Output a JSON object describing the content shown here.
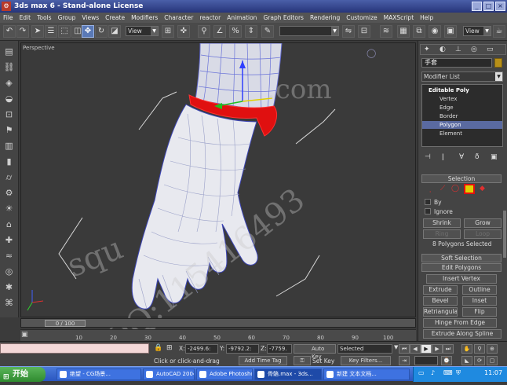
{
  "window": {
    "title": "3ds max 6 - Stand-alone License",
    "controls": [
      "_",
      "□",
      "×"
    ]
  },
  "menu": [
    "File",
    "Edit",
    "Tools",
    "Group",
    "Views",
    "Create",
    "Modifiers",
    "Character",
    "reactor",
    "Animation",
    "Graph Editors",
    "Rendering",
    "Customize",
    "MAXScript",
    "Help"
  ],
  "toolbar": {
    "ref_coord": "View",
    "named_selection": "",
    "right_dropdown": "View"
  },
  "viewport": {
    "label": "Perspective",
    "background": "#3a3a3a",
    "selection_color": "#e01010"
  },
  "watermarks": {
    "url": ".com",
    "qq": "QQ:115416493",
    "left": "squ"
  },
  "command_panel": {
    "object_name": "手套",
    "modifier_list": "Modifier List",
    "stack": {
      "root": "Editable Poly",
      "items": [
        "Vertex",
        "Edge",
        "Border",
        "Polygon",
        "Element"
      ],
      "selected": "Polygon"
    },
    "selection": {
      "title": "Selection",
      "by_label": "By",
      "ignore_label": "Ignore",
      "shrink": "Shrink",
      "grow": "Grow",
      "ring": "Ring",
      "loop": "Loop",
      "status": "8 Polygons Selected"
    },
    "soft_selection": "Soft Selection",
    "edit_polygons": {
      "title": "Edit Polygons",
      "insert_vertex": "Insert Vertex",
      "extrude": "Extrude",
      "outline": "Outline",
      "bevel": "Bevel",
      "inset": "Inset",
      "retriangulate": "Retriangulate",
      "flip": "Flip",
      "hinge": "Hinge From Edge",
      "extrude_spline": "Extrude Along Spline"
    }
  },
  "timeline": {
    "frame": "0 / 100",
    "ticks": [
      "10",
      "20",
      "30",
      "40",
      "50",
      "60",
      "70",
      "80",
      "90",
      "100"
    ]
  },
  "status": {
    "x_label": "X:",
    "x": "-2499.6:",
    "y_label": "Y:",
    "y": "-9792.2:",
    "z_label": "Z:",
    "z": "-7759.",
    "prompt": "Click or click-and-drag",
    "add_time_tag": "Add Time Tag",
    "auto_key": "Auto Key",
    "selected": "Selected",
    "set_key": "Set Key",
    "key_filters": "Key Filters..."
  },
  "taskbar": {
    "start": "开始",
    "tasks": [
      "绝望 - CG场景...",
      "AutoCAD 2004 ...",
      "Adobe Photoshop",
      "骨骼.max - 3ds...",
      "新建 文本文档..."
    ],
    "time": "11:07"
  }
}
